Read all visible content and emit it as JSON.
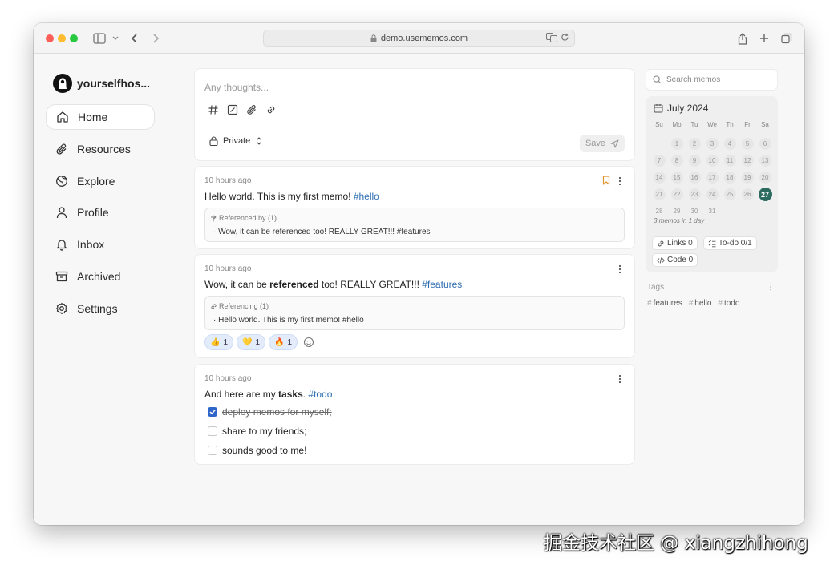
{
  "browser": {
    "url": "demo.usememos.com"
  },
  "sidebar": {
    "brand": "yourselfhos...",
    "items": [
      {
        "label": "Home",
        "icon": "home-icon"
      },
      {
        "label": "Resources",
        "icon": "paperclip-icon"
      },
      {
        "label": "Explore",
        "icon": "globe-icon"
      },
      {
        "label": "Profile",
        "icon": "user-icon"
      },
      {
        "label": "Inbox",
        "icon": "bell-icon"
      },
      {
        "label": "Archived",
        "icon": "archive-icon"
      },
      {
        "label": "Settings",
        "icon": "gear-icon"
      }
    ]
  },
  "editor": {
    "placeholder": "Any thoughts...",
    "visibility": "Private",
    "save_label": "Save"
  },
  "memos": [
    {
      "time": "10 hours ago",
      "text": "Hello world. This is my first memo! ",
      "tag": "#hello",
      "ref_title": "Referenced by (1)",
      "ref_line": "Wow, it can be referenced too! REALLY GREAT!!! #features"
    },
    {
      "time": "10 hours ago",
      "text_a": "Wow, it can be ",
      "text_bold": "referenced",
      "text_b": " too! REALLY GREAT!!! ",
      "tag": "#features",
      "ref_title": "Referencing (1)",
      "ref_line": "Hello world. This is my first memo! #hello",
      "reactions": [
        {
          "emoji": "👍",
          "count": "1"
        },
        {
          "emoji": "💛",
          "count": "1"
        },
        {
          "emoji": "🔥",
          "count": "1"
        }
      ]
    },
    {
      "time": "10 hours ago",
      "text_a": "And here are my ",
      "text_bold": "tasks",
      "text_b": ". ",
      "tag": "#todo",
      "tasks": [
        {
          "label": "deploy memos for myself;",
          "done": true
        },
        {
          "label": "share to my friends;",
          "done": false
        },
        {
          "label": "sounds good to me!",
          "done": false
        }
      ]
    }
  ],
  "search": {
    "placeholder": "Search memos"
  },
  "calendar": {
    "month": "July 2024",
    "weekdays": [
      "Su",
      "Mo",
      "Tu",
      "We",
      "Th",
      "Fr",
      "Sa"
    ],
    "today": "27",
    "summary": "3 memos in 1 day"
  },
  "stats": {
    "links": "Links 0",
    "todo": "To-do 0/1",
    "code": "Code 0"
  },
  "tags": {
    "heading": "Tags",
    "items": [
      "features",
      "hello",
      "todo"
    ]
  },
  "watermark": "掘金技术社区 @ xiangzhihong",
  "colors": {
    "accent_blue": "#2b6cb0",
    "today_green": "#2d6a5f",
    "bookmark_orange": "#e0952b"
  }
}
